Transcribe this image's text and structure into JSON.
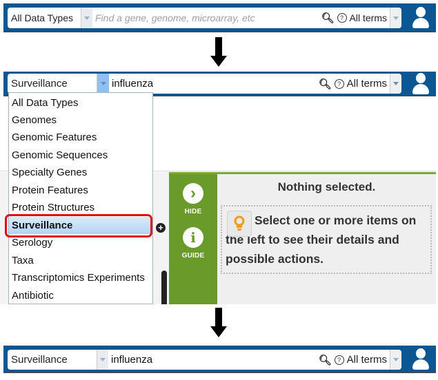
{
  "step1": {
    "data_type": "All Data Types",
    "search_placeholder": "Find a gene, genome, microarray, etc",
    "search_value": "",
    "search_icon": "magnifier-icon",
    "help_icon": "question-circle-icon",
    "help_glyph": "?",
    "terms": "All terms",
    "user_icon": "user-icon"
  },
  "step2": {
    "data_type": "Surveillance",
    "search_value": "influenza",
    "terms": "All terms",
    "help_glyph": "?",
    "dropdown_options": [
      "All Data Types",
      "Genomes",
      "Genomic Features",
      "Genomic Sequences",
      "Specialty Genes",
      "Protein Features",
      "Protein Structures",
      "Surveillance",
      "Serology",
      "Taxa",
      "Transcriptomics Experiments",
      "Antibiotic"
    ],
    "selected_option": "Surveillance",
    "side_panel": {
      "hide_label": "HIDE",
      "guide_label": "GUIDE",
      "hide_glyph": "›",
      "guide_glyph": "i",
      "title": "Nothing selected.",
      "hint": "Select one or more items on the left to see their details and possible actions.",
      "plus_glyph": "+"
    },
    "accent_green": "#6a9a2a",
    "highlight_color": "#e01010"
  },
  "step3": {
    "data_type": "Surveillance",
    "search_value": "influenza",
    "terms": "All terms",
    "help_glyph": "?"
  },
  "colors": {
    "header_blue": "#0a5794"
  }
}
